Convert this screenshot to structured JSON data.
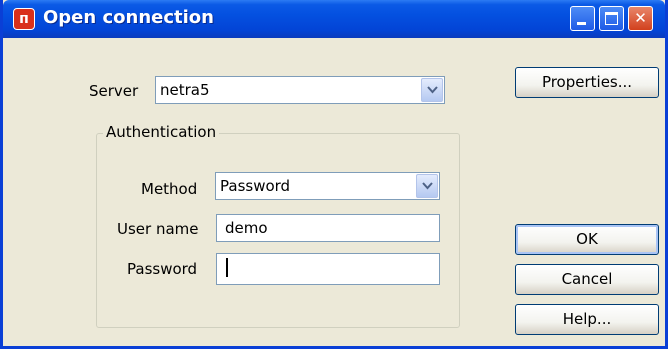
{
  "window": {
    "title": "Open connection",
    "icon": "app-logo-icon"
  },
  "form": {
    "server_label": "Server",
    "server_value": "netra5",
    "auth_group_title": "Authentication",
    "method_label": "Method",
    "method_value": "Password",
    "username_label": "User name",
    "username_value": "demo",
    "password_label": "Password",
    "password_value": ""
  },
  "buttons": {
    "properties": "Properties...",
    "ok": "OK",
    "cancel": "Cancel",
    "help": "Help..."
  },
  "colors": {
    "titlebar": "#0450e0",
    "window_bg": "#ece9d8",
    "close_button": "#d2401d"
  }
}
